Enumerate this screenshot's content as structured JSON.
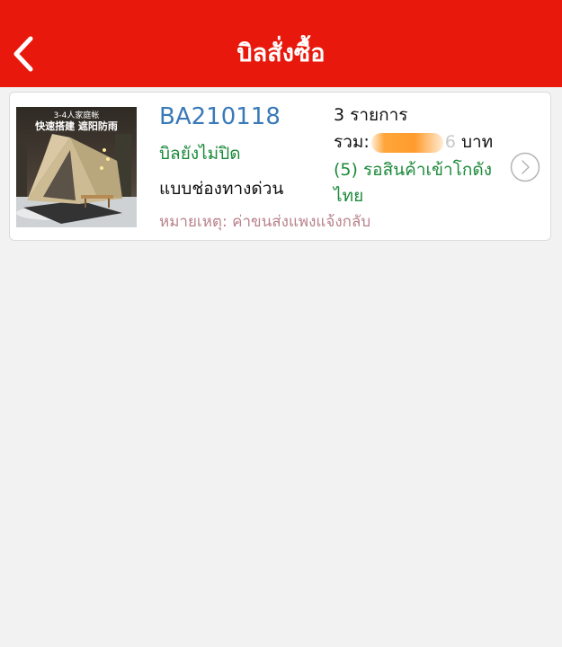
{
  "header": {
    "title": "บิลสั่งซื้อ",
    "back_icon": "chevron-left-icon"
  },
  "colors": {
    "header_bg": "#e8190c",
    "order_id": "#3a7ab8",
    "status_green": "#1c8a3a",
    "note_pink": "#b9828c"
  },
  "orders": [
    {
      "thumbnail": {
        "caption_line1": "3-4人家庭帐",
        "caption_line2": "快速搭建 遮阳防雨"
      },
      "order_id": "BA210118",
      "bill_status": "บิลยังไม่ปิด",
      "shipping_method": "แบบช่องทางด่วน",
      "note": "หมายเหตุ: ค่าขนส่งแพงแจ้งกลับ",
      "items_count": "3 รายการ",
      "total_label": "รวม:",
      "total_visible_digit": "6",
      "total_currency": "บาท",
      "wait_status": "(5) รอสินค้าเข้าโกดังไทย",
      "chevron_icon": "chevron-right-circle-icon"
    }
  ]
}
